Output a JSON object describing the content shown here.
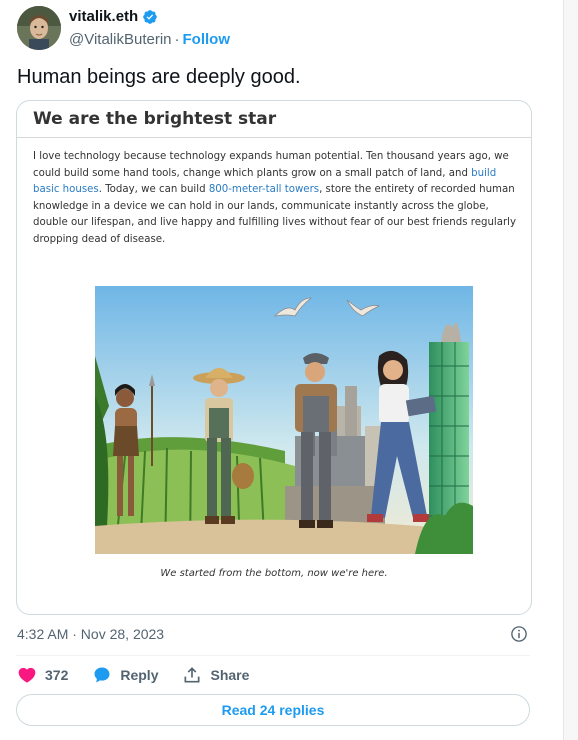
{
  "author": {
    "display_name": "vitalik.eth",
    "handle": "@VitalikButerin",
    "separator": "·",
    "follow_label": "Follow"
  },
  "tweet": {
    "text": "Human beings are deeply good.",
    "timestamp": "4:32 AM · Nov 28, 2023"
  },
  "card": {
    "title": "We are the brightest star",
    "body": {
      "part1": "I love technology because technology expands human potential. Ten thousand years ago, we could build some hand tools, change which plants grow on a small patch of land, and ",
      "link1": "build basic houses",
      "part2": ". Today, we can build ",
      "link2": "800-meter-tall towers",
      "part3": ", store the entirety of recorded human knowledge in a device we can hold in our lands, communicate instantly across the globe, double our lifespan, and live happy and fulfilling lives without fear of our best friends regularly dropping dead of disease."
    },
    "caption": "We started from the bottom, now we're here."
  },
  "actions": {
    "likes_count": "372",
    "reply_label": "Reply",
    "share_label": "Share"
  },
  "read_replies_label": "Read 24 replies",
  "colors": {
    "accent": "#1d9bf0",
    "like": "#f91880",
    "text_secondary": "#536471"
  }
}
